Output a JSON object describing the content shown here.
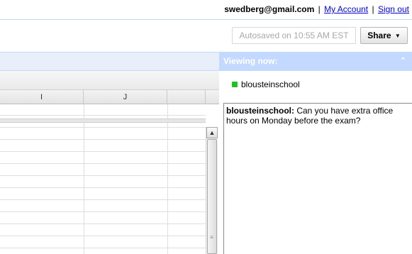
{
  "account": {
    "email": "swedberg@gmail.com",
    "separator": "|",
    "my_account": "My Account",
    "sign_out": "Sign out"
  },
  "toolbar": {
    "autosave": "Autosaved on 10:55 AM EST",
    "share_label": "Share",
    "share_caret": "▼"
  },
  "grid": {
    "columns": [
      "I",
      "J"
    ]
  },
  "panel": {
    "title": "Viewing now:",
    "collapse_icon": "⌃",
    "viewers": [
      {
        "name": "blousteinschool",
        "status_color": "#1ec21e"
      }
    ]
  },
  "chat": {
    "messages": [
      {
        "sender": "blousteinschool:",
        "text": " Can you have extra office hours on Monday before the exam?"
      }
    ]
  },
  "scrollbar": {
    "up_arrow": "▲"
  },
  "colors": {
    "link": "#0000cc",
    "panel_header": "#c3d9ff",
    "autosave_text": "#a8a8a8"
  }
}
